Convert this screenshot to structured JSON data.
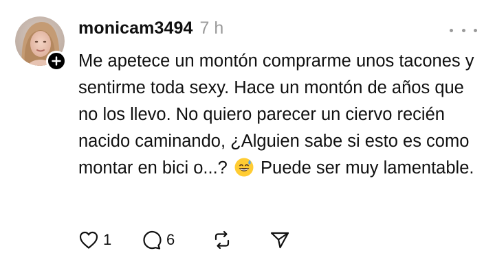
{
  "post": {
    "username": "monicam3494",
    "time": "7 h",
    "text_before_emoji": "Me apetece un montón comprarme unos tacones y sentirme toda sexy. Hace un montón de años que no los llevo. No quiero parecer un ciervo recién nacido caminando, ¿Alguien sabe si esto es como montar en bici o...? ",
    "text_after_emoji": " Puede ser muy lamentable.",
    "emoji": "grinning-sweat-emoji",
    "likes": "1",
    "replies": "6"
  },
  "icons": {
    "avatar": "user-photo",
    "follow": "plus-icon",
    "more": "more-horizontal-icon",
    "like": "heart-icon",
    "reply": "comment-icon",
    "repost": "repost-icon",
    "share": "send-icon"
  },
  "colors": {
    "text": "#101010",
    "muted": "#9a9a9a",
    "background": "#ffffff"
  }
}
